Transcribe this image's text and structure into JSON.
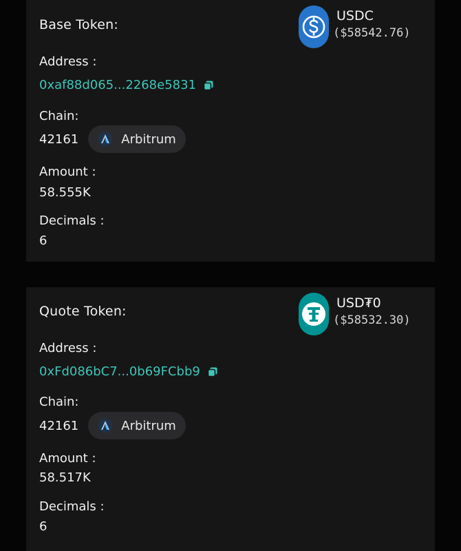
{
  "base": {
    "title": "Base Token:",
    "symbol": "USDC",
    "price": "($58542.76)",
    "address_label": "Address :",
    "address": "0xaf88d065...2268e5831",
    "chain_label": "Chain:",
    "chain_id": "42161",
    "chain_name": "Arbitrum",
    "amount_label": "Amount :",
    "amount": "58.555K",
    "decimals_label": "Decimals :",
    "decimals": "6",
    "logo_icon": "usdc-logo-icon",
    "logo_color": "#2775ca"
  },
  "quote": {
    "title": "Quote Token:",
    "symbol": "USD₮0",
    "price": "($58532.30)",
    "address_label": "Address :",
    "address": "0xFd086bC7...0b69FCbb9",
    "chain_label": "Chain:",
    "chain_id": "42161",
    "chain_name": "Arbitrum",
    "amount_label": "Amount :",
    "amount": "58.517K",
    "decimals_label": "Decimals :",
    "decimals": "6",
    "logo_icon": "usdt0-logo-icon",
    "logo_color": "#009393"
  },
  "colors": {
    "address": "#3fc6b9",
    "card_bg": "#161616",
    "page_bg": "#050505",
    "pill_bg": "#2a2a2d"
  }
}
